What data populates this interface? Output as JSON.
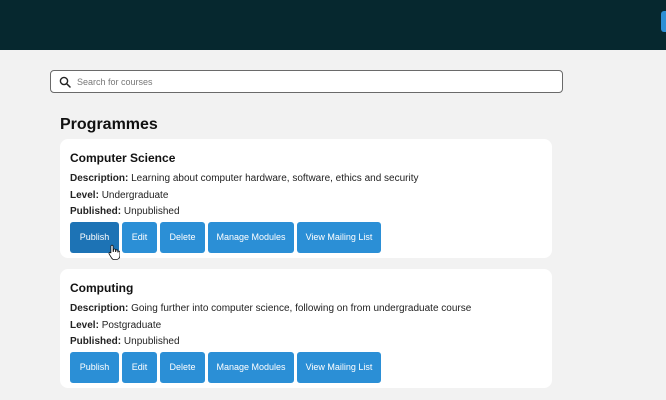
{
  "search": {
    "placeholder": "Search for courses",
    "icon": "search-icon"
  },
  "page": {
    "heading": "Programmes"
  },
  "labels": {
    "description": "Description:",
    "level": "Level:",
    "published": "Published:"
  },
  "buttons": {
    "publish": "Publish",
    "edit": "Edit",
    "delete": "Delete",
    "manage_modules": "Manage Modules",
    "view_mailing_list": "View Mailing List"
  },
  "programmes": [
    {
      "title": "Computer Science",
      "description": "Learning about computer hardware, software, ethics and security",
      "level": "Undergraduate",
      "published": "Unpublished"
    },
    {
      "title": "Computing",
      "description": "Going further into computer science, following on from undergraduate course",
      "level": "Postgraduate",
      "published": "Unpublished"
    }
  ],
  "colors": {
    "topbar": "#06282f",
    "button": "#2b8fd6",
    "button_hover": "#1d73b5",
    "background": "#f2f2f2",
    "card": "#ffffff"
  }
}
